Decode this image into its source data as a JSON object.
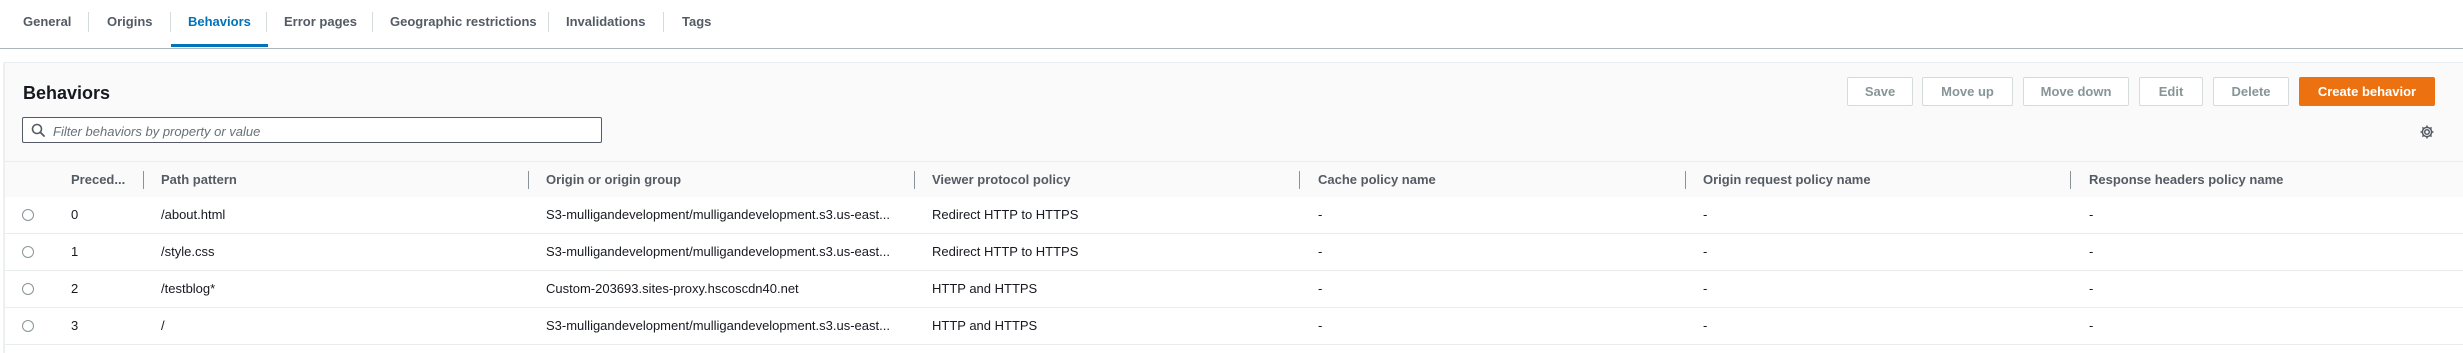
{
  "tabs": [
    {
      "label": "General"
    },
    {
      "label": "Origins"
    },
    {
      "label": "Behaviors"
    },
    {
      "label": "Error pages"
    },
    {
      "label": "Geographic restrictions"
    },
    {
      "label": "Invalidations"
    },
    {
      "label": "Tags"
    }
  ],
  "active_tab": "Behaviors",
  "panel": {
    "title": "Behaviors",
    "buttons": {
      "save": "Save",
      "move_up": "Move up",
      "move_down": "Move down",
      "edit": "Edit",
      "delete": "Delete",
      "create": "Create behavior"
    },
    "filter": {
      "placeholder": "Filter behaviors by property or value",
      "value": ""
    }
  },
  "table": {
    "columns": [
      "Preced...",
      "Path pattern",
      "Origin or origin group",
      "Viewer protocol policy",
      "Cache policy name",
      "Origin request policy name",
      "Response headers policy name"
    ],
    "rows": [
      {
        "precedence": "0",
        "path": "/about.html",
        "origin": "S3-mulligandevelopment/mulligandevelopment.s3.us-east...",
        "viewer": "Redirect HTTP to HTTPS",
        "cache": "-",
        "origin_request": "-",
        "response_headers": "-"
      },
      {
        "precedence": "1",
        "path": "/style.css",
        "origin": "S3-mulligandevelopment/mulligandevelopment.s3.us-east...",
        "viewer": "Redirect HTTP to HTTPS",
        "cache": "-",
        "origin_request": "-",
        "response_headers": "-"
      },
      {
        "precedence": "2",
        "path": "/testblog*",
        "origin": "Custom-203693.sites-proxy.hscoscdn40.net",
        "viewer": "HTTP and HTTPS",
        "cache": "-",
        "origin_request": "-",
        "response_headers": "-"
      },
      {
        "precedence": "3",
        "path": "/",
        "origin": "S3-mulligandevelopment/mulligandevelopment.s3.us-east...",
        "viewer": "HTTP and HTTPS",
        "cache": "-",
        "origin_request": "-",
        "response_headers": "-"
      }
    ]
  },
  "colors": {
    "accent": "#0073bb",
    "primary_button": "#ec7211"
  }
}
